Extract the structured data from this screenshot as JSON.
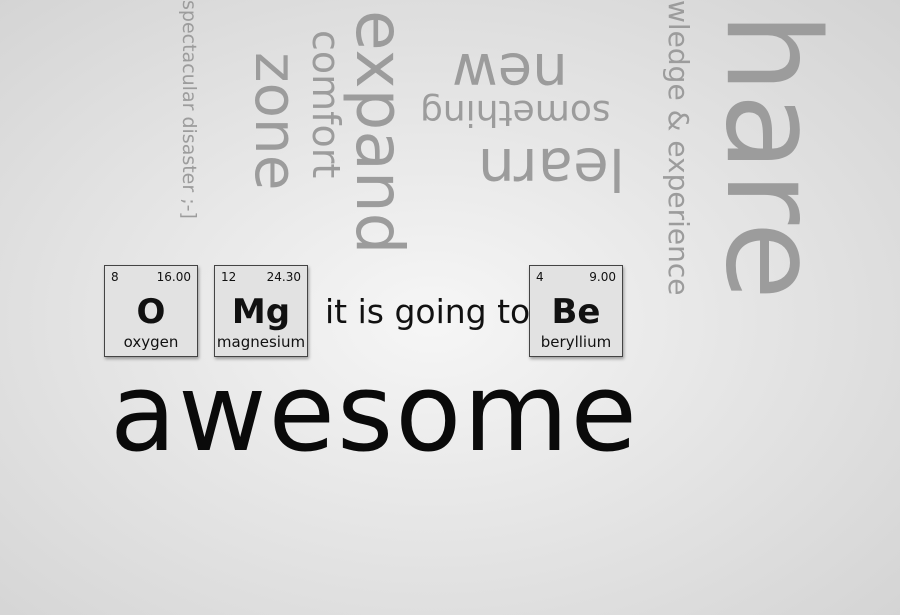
{
  "cloud": {
    "spectacular": "spectacular disaster ;-]",
    "zone": "zone",
    "comfort": "comfort",
    "expand": "expand",
    "new": "new",
    "something": "something",
    "learn": "learn",
    "knowledge": "wledge & experience",
    "share": "hare"
  },
  "elements": [
    {
      "number": "8",
      "mass": "16.00",
      "symbol": "O",
      "name": "oxygen"
    },
    {
      "number": "12",
      "mass": "24.30",
      "symbol": "Mg",
      "name": "magnesium"
    },
    {
      "number": "4",
      "mass": "9.00",
      "symbol": "Be",
      "name": "beryllium"
    }
  ],
  "phrase": "it is going to",
  "headline": "awesome",
  "colors": {
    "cloud_text": "#9c9c9c",
    "main_text": "#0a0a0a",
    "tile_bg": "#e2e2e2"
  }
}
